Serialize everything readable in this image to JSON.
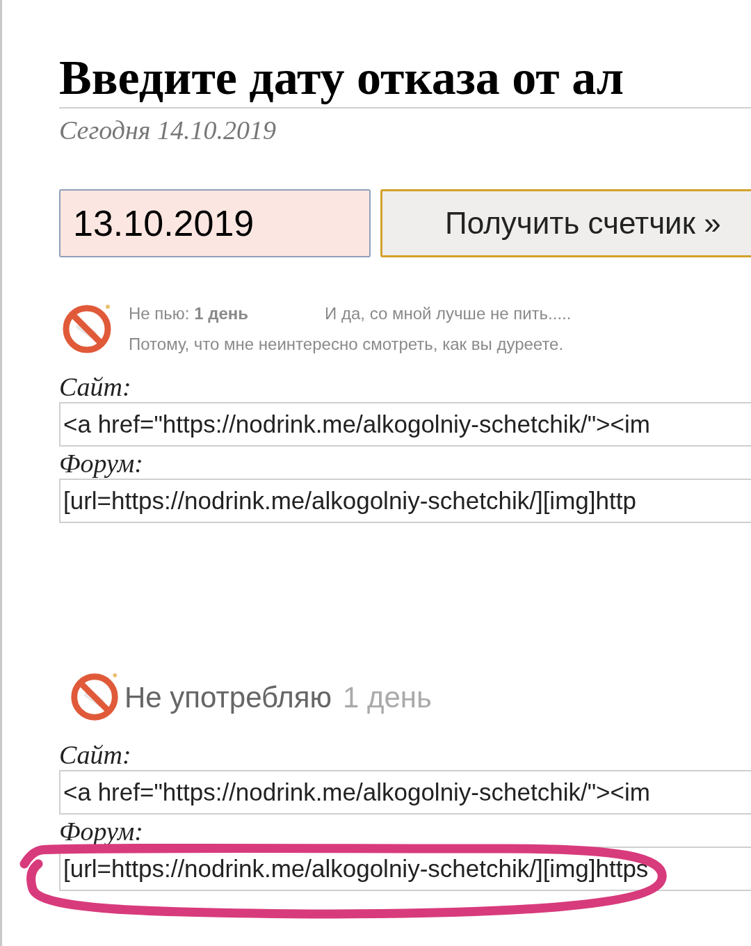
{
  "heading": "Введите дату отказа от ал",
  "today": "Сегодня 14.10.2019",
  "date_field": {
    "value": "13.10.2019"
  },
  "submit_button": "Получить счетчик »",
  "sections": [
    {
      "banner": {
        "kind": "two-line",
        "lines": [
          "Не пью: **1 день**",
          "И да, со мной лучше не пить.....",
          "Потому, что мне неинтересно смотреть, как вы дуреете."
        ]
      },
      "codes": [
        {
          "label": "Сайт:",
          "value": "<a href=\"https://nodrink.me/alkogolniy-schetchik/\"><im",
          "circled": false
        },
        {
          "label": "Форум:",
          "value": "[url=https://nodrink.me/alkogolniy-schetchik/][img]http",
          "circled": false
        }
      ]
    },
    {
      "banner": {
        "kind": "one-line",
        "lines": [
          "Не употребляю",
          "1 день"
        ]
      },
      "codes": [
        {
          "label": "Сайт:",
          "value": "<a href=\"https://nodrink.me/alkogolniy-schetchik/\"><im",
          "circled": false
        },
        {
          "label": "Форум:",
          "value": "[url=https://nodrink.me/alkogolniy-schetchik/][img]https",
          "circled": true
        }
      ]
    }
  ]
}
